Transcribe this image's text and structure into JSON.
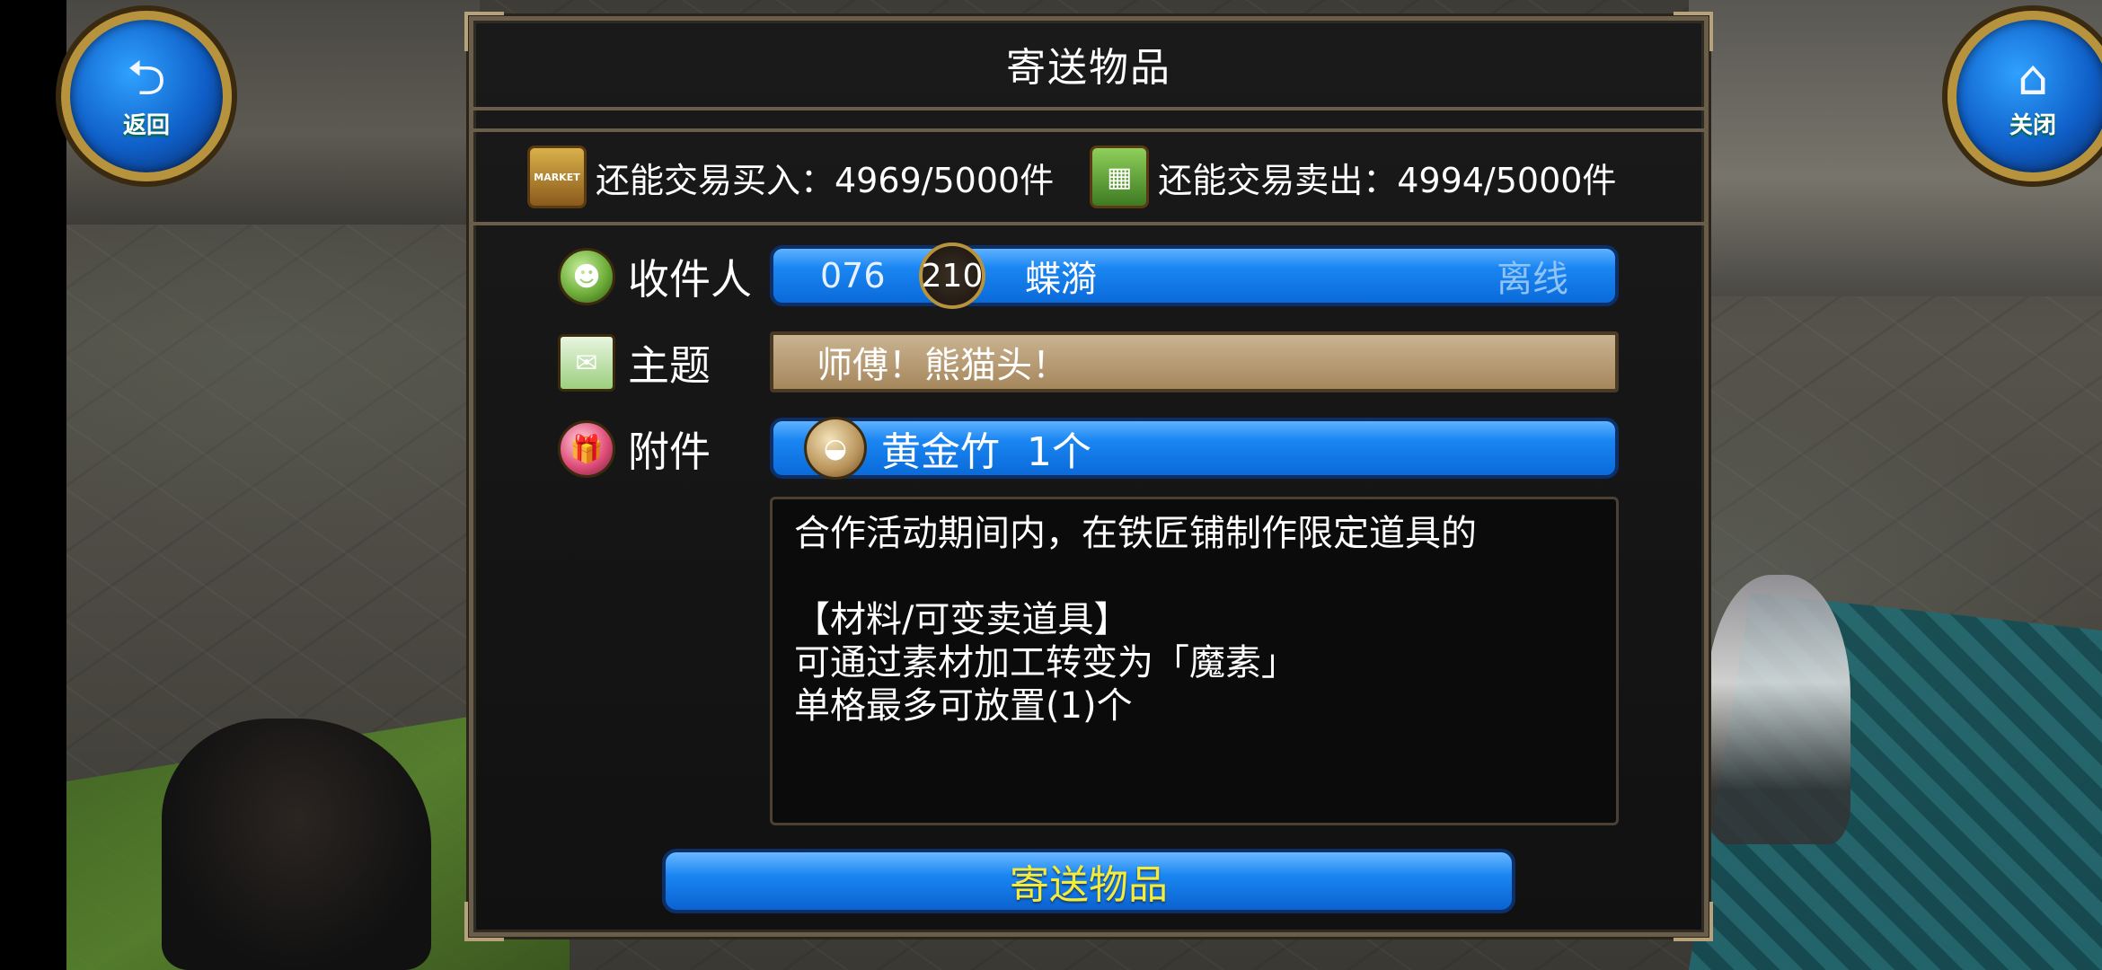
{
  "nav": {
    "back_label": "返回",
    "close_label": "关闭"
  },
  "dialog": {
    "title": "寄送物品",
    "quota": {
      "buy_text": "还能交易买入：4969/5000件",
      "sell_text": "还能交易卖出：4994/5000件",
      "buy_icon_text": "MARKET"
    },
    "recipient": {
      "label": "收件人",
      "id": "076",
      "level": "210",
      "name": "蝶漪",
      "status": "离线"
    },
    "subject": {
      "label": "主题",
      "value": "师傅！熊猫头！"
    },
    "attachment": {
      "label": "附件",
      "item_name": "黄金竹",
      "quantity": "1个"
    },
    "description": {
      "line1": "合作活动期间内，在铁匠铺制作限定道具的",
      "line2": "【材料/可变卖道具】",
      "line3": "可通过素材加工转变为「魔素」",
      "line4": "单格最多可放置(1)个"
    },
    "send_button": "寄送物品"
  },
  "colors": {
    "button_blue": "#1a86f2",
    "send_text_yellow": "#f5ec3a",
    "panel_border": "#6a5d4a",
    "subject_tan": "#b89a6e"
  },
  "icons": {
    "back": "return-arrow-icon",
    "close": "home-icon",
    "recipient": "people-icon",
    "subject": "envelope-icon",
    "attachment": "gift-icon",
    "item": "sack-icon"
  }
}
